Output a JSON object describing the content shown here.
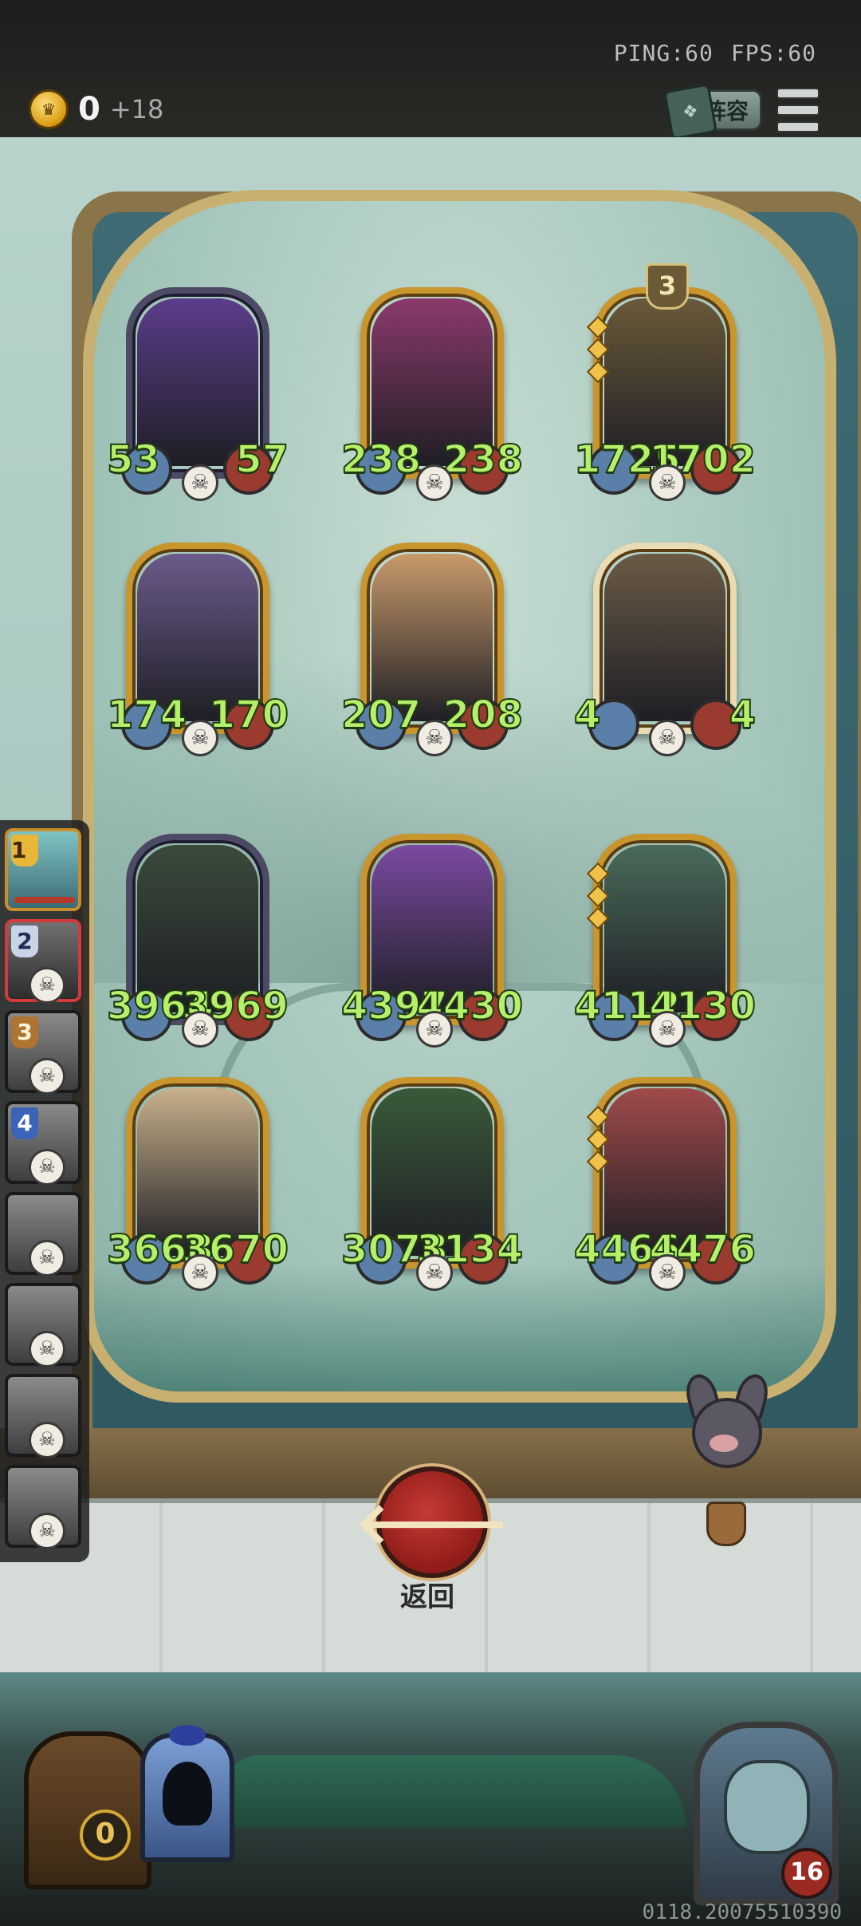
{
  "topbar": {
    "ping": "PING:60",
    "fps": "FPS:60",
    "gold": "0",
    "gold_income": "+18",
    "lineup_label": "阵容"
  },
  "board": {
    "cards": [
      {
        "attack": "53",
        "health": "57",
        "style": "dark"
      },
      {
        "attack": "238",
        "health": "238",
        "style": "gold"
      },
      {
        "attack": "1725",
        "health": "1702",
        "style": "gold",
        "tier": "3"
      },
      {
        "attack": "174",
        "health": "170",
        "style": "gold"
      },
      {
        "attack": "207",
        "health": "208",
        "style": "gold"
      },
      {
        "attack": "4",
        "health": "4",
        "style": "plain"
      },
      {
        "attack": "3964",
        "health": "3969",
        "style": "dark"
      },
      {
        "attack": "4397",
        "health": "4430",
        "style": "gold"
      },
      {
        "attack": "4112",
        "health": "4130",
        "style": "gold"
      },
      {
        "attack": "3668",
        "health": "3670",
        "style": "gold"
      },
      {
        "attack": "3078",
        "health": "3134",
        "style": "gold"
      },
      {
        "attack": "4466",
        "health": "4476",
        "style": "gold"
      }
    ]
  },
  "bench": {
    "slots": [
      {
        "rank": "1"
      },
      {
        "rank": "2"
      },
      {
        "rank": "3"
      },
      {
        "rank": "4"
      },
      {
        "rank": ""
      },
      {
        "rank": ""
      },
      {
        "rank": ""
      },
      {
        "rank": ""
      }
    ]
  },
  "back_label": "返回",
  "bottom": {
    "chest_count": "0",
    "hero_health": "16",
    "build": "0118.20075510390"
  },
  "icons": {
    "coin": "crown-coin-icon",
    "skull": "☠",
    "back": "🡐"
  }
}
